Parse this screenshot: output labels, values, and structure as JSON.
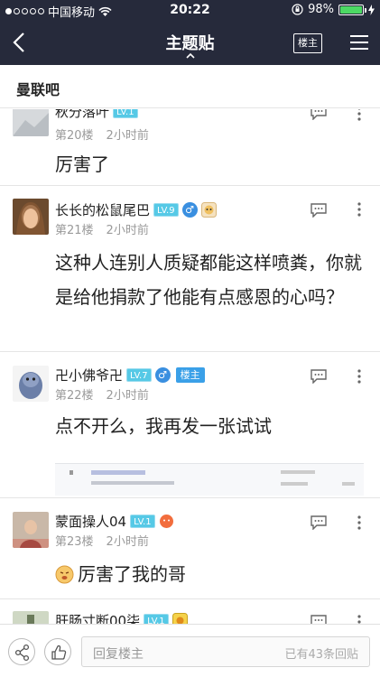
{
  "status": {
    "carrier": "中国移动",
    "time": "20:22",
    "battery": "98%",
    "battery_level": 0.98
  },
  "nav": {
    "title": "主题贴",
    "owner_only_label": "楼主"
  },
  "forum": {
    "name": "曼联吧"
  },
  "posts": [
    {
      "username": "秋分落叶",
      "level": "LV.1",
      "floor": "第20楼",
      "time": "2小时前",
      "content": "厉害了",
      "has_gender": false,
      "is_owner": false
    },
    {
      "username": "长长的松鼠尾巴",
      "level": "LV.9",
      "floor": "第21楼",
      "time": "2小时前",
      "content": "这种人连别人质疑都能这样喷粪，你就是给他捐款了他能有点感恩的心吗？",
      "has_gender": true,
      "is_owner": false
    },
    {
      "username": "卍小佛爷卍",
      "level": "LV.7",
      "floor": "第22楼",
      "time": "2小时前",
      "content": "点不开么，我再发一张试试",
      "has_gender": true,
      "is_owner": true,
      "owner_badge": "楼主"
    },
    {
      "username": "蒙面操人04",
      "level": "LV.1",
      "floor": "第23楼",
      "time": "2小时前",
      "content": "厉害了我的哥",
      "has_gender": false,
      "is_owner": false
    },
    {
      "username": "肝肠寸断00柒",
      "level": "LV.1",
      "floor": "",
      "time": "",
      "content": "",
      "has_gender": false,
      "is_owner": false
    }
  ],
  "gender_symbol": "♂",
  "bottom": {
    "placeholder": "回复楼主",
    "reply_count": "已有43条回贴"
  }
}
